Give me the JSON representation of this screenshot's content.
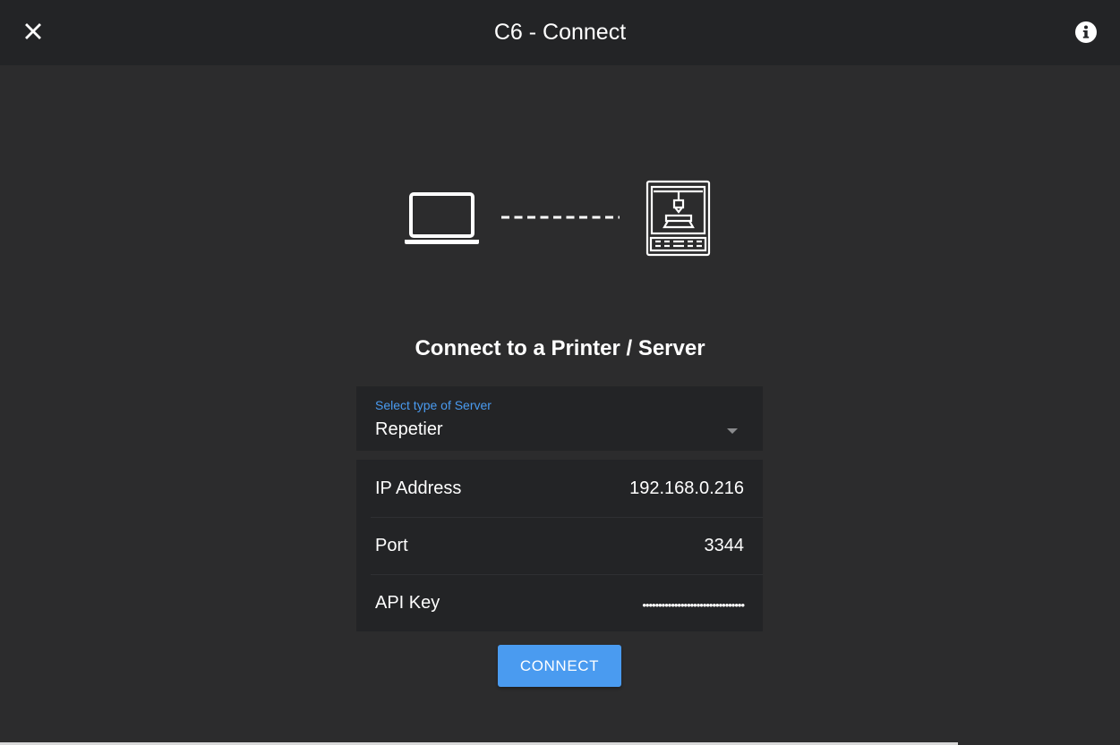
{
  "window": {
    "title": "C6 - Connect",
    "close_icon": "close-icon",
    "info_icon": "info-icon"
  },
  "hero": {
    "left_icon": "laptop-icon",
    "right_icon": "3d-printer-icon"
  },
  "main": {
    "heading": "Connect to a Printer / Server",
    "server_select": {
      "label": "Select type of Server",
      "value": "Repetier"
    },
    "fields": [
      {
        "label": "IP Address",
        "value": "192.168.0.216"
      },
      {
        "label": "Port",
        "value": "3344"
      },
      {
        "label": "API Key",
        "value": "••••••••••••••••••••••••••••••••"
      }
    ],
    "connect_label": "CONNECT"
  },
  "colors": {
    "accent": "#4a9bf0",
    "background": "#2c2c2d",
    "titlebar": "#232426",
    "panel": "#232426"
  }
}
